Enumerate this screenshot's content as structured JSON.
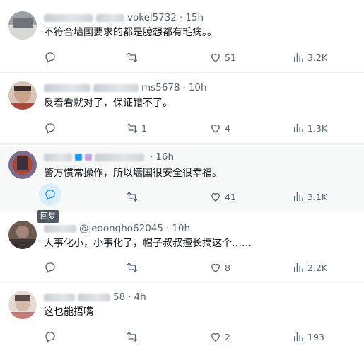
{
  "colors": {
    "text": "#0f1419",
    "muted": "#536471",
    "reply_hover": "#1d9bf0"
  },
  "replies": [
    {
      "handle": "vokel5732",
      "time": "15h",
      "text": "不符合墙国要求的都是臆想都有毛病。。",
      "stats": {
        "retweets": "",
        "likes": "51",
        "views": "3.2K"
      }
    },
    {
      "handle": "ms5678",
      "time": "10h",
      "text": "反着看就对了，保证错不了。",
      "stats": {
        "retweets": "1",
        "likes": "4",
        "views": "1.3K"
      }
    },
    {
      "handle": "",
      "time": "16h",
      "text": "警方惯常操作，所以墙国很安全很幸福。",
      "stats": {
        "retweets": "",
        "likes": "41",
        "views": "3.1K"
      }
    },
    {
      "handle": "@jeoongho62045",
      "time": "10h",
      "text": "大事化小，小事化了，帽子叔叔擅长搞这个……",
      "stats": {
        "retweets": "",
        "likes": "8",
        "views": "2.2K"
      }
    },
    {
      "handle": "58",
      "time": "4h",
      "text": "这也能捂嘴",
      "stats": {
        "retweets": "",
        "likes": "2",
        "views": "193"
      }
    }
  ],
  "tooltip": "回复",
  "icons": [
    "reply-icon",
    "retweet-icon",
    "like-icon",
    "views-icon"
  ]
}
